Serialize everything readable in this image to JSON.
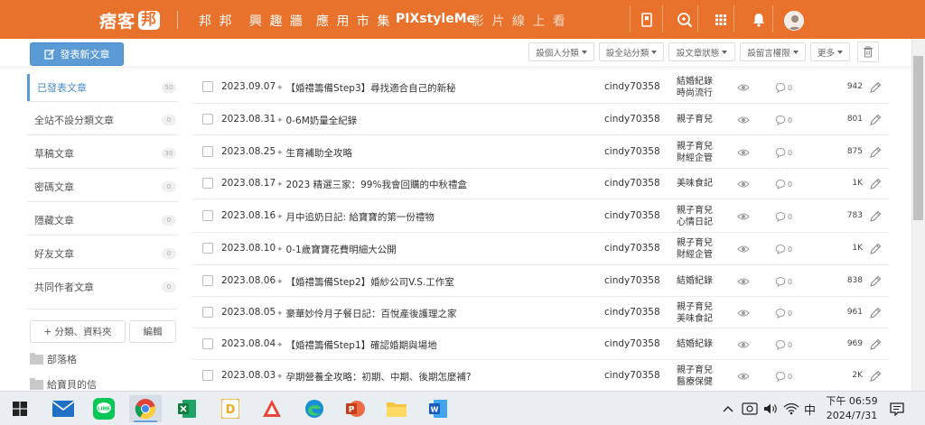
{
  "header": {
    "logo_text": "痞客",
    "logo_badge": "邦",
    "nav": [
      "邦 邦",
      "興 趣 牆",
      "應 用 市 集",
      "PIXstyleMe",
      "影 片 線 上 看"
    ],
    "icons": [
      "bookmark-icon",
      "search-icon",
      "apps-icon",
      "bell-icon",
      "avatar"
    ]
  },
  "toolbar": {
    "publish_label": "發表新文章",
    "filters": [
      "設個人分類",
      "設全站分類",
      "設文章狀態",
      "設留言權限",
      "更多"
    ]
  },
  "sidebar": {
    "items": [
      {
        "label": "已發表文章",
        "count": "50"
      },
      {
        "label": "全站不設分類文章",
        "count": "0"
      },
      {
        "label": "草稿文章",
        "count": "30"
      },
      {
        "label": "密碼文章",
        "count": "0"
      },
      {
        "label": "隱藏文章",
        "count": "0"
      },
      {
        "label": "好友文章",
        "count": "0"
      },
      {
        "label": "共同作者文章",
        "count": "0"
      }
    ],
    "add_label": "+  分類、資料夾",
    "edit_label": "編輯",
    "folders": [
      "部落格",
      "給寶貝的信"
    ]
  },
  "articles": [
    {
      "date": "2023.09.07",
      "title": "【婚禮籌備Step3】尋找適合自己的新秘",
      "author": "cindy70358",
      "cats": [
        "結婚紀錄",
        "時尚流行"
      ],
      "comments": "0",
      "views": "942"
    },
    {
      "date": "2023.08.31",
      "title": "0-6M奶量全紀錄",
      "author": "cindy70358",
      "cats": [
        "親子育兒"
      ],
      "comments": "0",
      "views": "801"
    },
    {
      "date": "2023.08.25",
      "title": "生育補助全攻略",
      "author": "cindy70358",
      "cats": [
        "親子育兒",
        "財經企管"
      ],
      "comments": "0",
      "views": "875"
    },
    {
      "date": "2023.08.17",
      "title": "2023 精選三家：99%我會回購的中秋禮盒",
      "author": "cindy70358",
      "cats": [
        "美味食記"
      ],
      "comments": "0",
      "views": "1K"
    },
    {
      "date": "2023.08.16",
      "title": "月中追奶日記: 給寶寶的第一份禮物",
      "author": "cindy70358",
      "cats": [
        "親子育兒",
        "心情日記"
      ],
      "comments": "0",
      "views": "783"
    },
    {
      "date": "2023.08.10",
      "title": "0-1歲寶寶花費明細大公開",
      "author": "cindy70358",
      "cats": [
        "親子育兒",
        "財經企管"
      ],
      "comments": "0",
      "views": "1K"
    },
    {
      "date": "2023.08.06",
      "title": "【婚禮籌備Step2】婚紗公司V.S.工作室",
      "author": "cindy70358",
      "cats": [
        "結婚紀錄"
      ],
      "comments": "0",
      "views": "838"
    },
    {
      "date": "2023.08.05",
      "title": "豪華妙伶月子餐日記：百悅產後護理之家",
      "author": "cindy70358",
      "cats": [
        "親子育兒",
        "美味食記"
      ],
      "comments": "0",
      "views": "961"
    },
    {
      "date": "2023.08.04",
      "title": "【婚禮籌備Step1】確認婚期與場地",
      "author": "cindy70358",
      "cats": [
        "結婚紀錄"
      ],
      "comments": "0",
      "views": "969"
    },
    {
      "date": "2023.08.03",
      "title": "孕期營養全攻略：初期、中期、後期怎麼補?",
      "author": "cindy70358",
      "cats": [
        "親子育兒",
        "醫療保健"
      ],
      "comments": "0",
      "views": "2K"
    }
  ],
  "taskbar": {
    "apps": [
      "windows-start",
      "mail",
      "line",
      "chrome",
      "excel",
      "d-app",
      "wps-presentation",
      "edge",
      "powerpoint",
      "file-explorer",
      "word"
    ],
    "ime": "中",
    "time": "下午 06:59",
    "date": "2024/7/31"
  },
  "colors": {
    "brand": "#e8722b",
    "accent": "#5b9bd5"
  }
}
